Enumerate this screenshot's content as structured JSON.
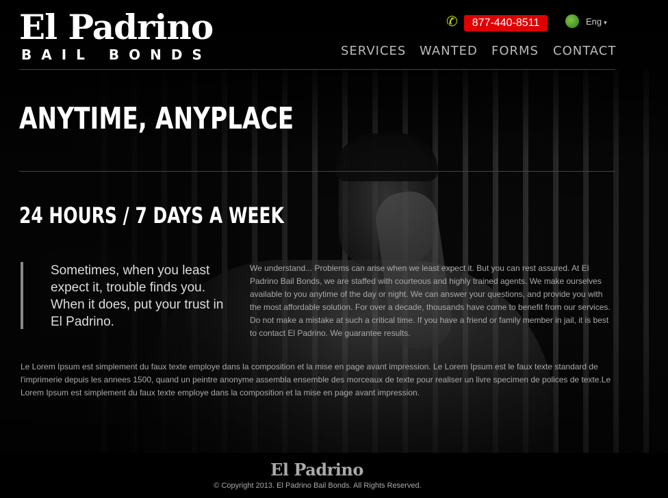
{
  "logo": {
    "title": "El Padrino",
    "subtitle": "BAIL BONDS"
  },
  "contact": {
    "phone": "877-440-8511",
    "phone_icon": "phone-icon"
  },
  "language": {
    "label": "Eng",
    "caret": "▾",
    "icon": "globe-icon"
  },
  "nav": {
    "items": [
      {
        "label": "SERVICES"
      },
      {
        "label": "WANTED"
      },
      {
        "label": "FORMS"
      },
      {
        "label": "CONTACT"
      }
    ]
  },
  "hero": {
    "headline": "ANYTIME, ANYPLACE",
    "subheadline": "24 HOURS / 7 DAYS A WEEK",
    "quote": "Sometimes, when you least expect it, trouble finds you. When it does, put your trust in El Padrino.",
    "body": "We understand... Problems can arise when we least expect it. But you can rest assured. At El Padrino Bail Bonds, we are staffed with courteous and highly trained agents. We make ourselves available to you anytime of the day or night. We can answer your questions, and provide you with the most affordable solution. For over a decade, thousands have come to benefit from our services. Do not make a mistake at such a critical time. If you have a friend or family member in jail, it is best to contact El Padrino. We guarantee results.",
    "lorem": "Le Lorem Ipsum est simplement du faux texte employe dans la composition et la mise en page avant impression. Le Lorem Ipsum est le faux texte standard de l'imprimerie depuis les annees 1500, quand un peintre anonyme assembla ensemble des morceaux de texte pour realiser un livre specimen de polices de texte.Le Lorem Ipsum est simplement du faux texte employe dans la composition et la mise en page avant impression."
  },
  "footer": {
    "logo": "El Padrino",
    "copyright": "© Copyright 2013. El Padrino Bail Bonds. All Rights Reserved."
  },
  "colors": {
    "phone_badge": "#dd0000",
    "phone_icon": "#c8e000",
    "globe": "#4fa030"
  }
}
